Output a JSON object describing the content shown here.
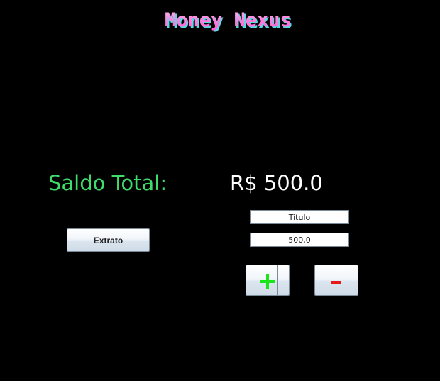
{
  "app": {
    "logo_text": "Money Nexus",
    "logo_colors": [
      "#ff5fd2",
      "#ffb3ec",
      "#5ff2ff"
    ]
  },
  "balance": {
    "label": "Saldo Total:",
    "value": "R$ 500.0",
    "label_color": "#3ddc6b",
    "value_color": "#ffffff"
  },
  "form": {
    "title_value": "Titulo",
    "amount_value": "500,0"
  },
  "buttons": {
    "extrato_label": "Extrato",
    "add_icon": "plus-icon",
    "add_color": "#19e619",
    "remove_icon": "minus-icon",
    "remove_color": "#e51b1b"
  }
}
